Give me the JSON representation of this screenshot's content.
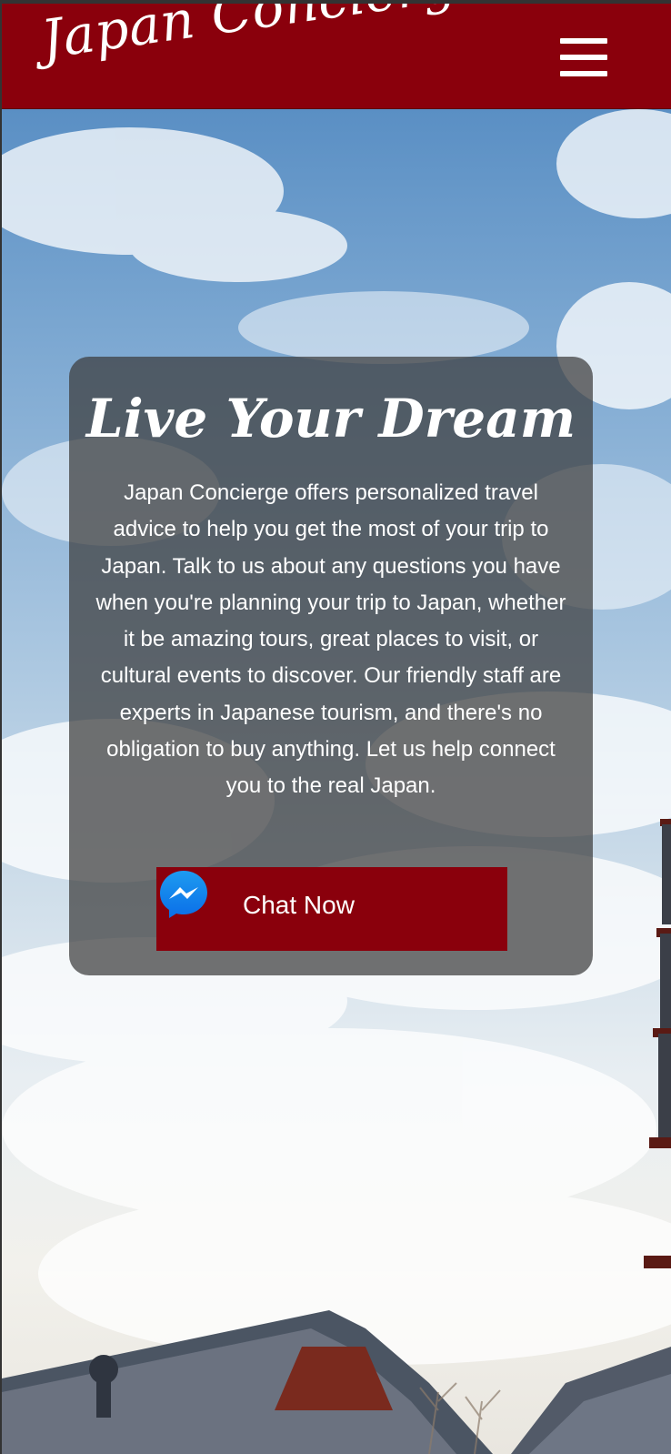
{
  "header": {
    "logo_text": "Japan Concierge",
    "menu_icon": "hamburger-menu-icon"
  },
  "hero": {
    "title": "Live Your Dream",
    "body": "Japan Concierge offers personalized travel advice to help you get the most of your trip to Japan. Talk to us about any questions you have when you're planning your trip to Japan, whether it be amazing tours, great places to visit, or cultural events to discover. Our friendly staff are experts in Japanese tourism, and there's no obligation to buy anything. Let us help connect you to the real Japan.",
    "cta_label": "Chat Now",
    "cta_icon": "messenger-icon"
  },
  "colors": {
    "brand_red": "#8a000c",
    "card_overlay": "rgba(60,60,60,0.72)",
    "text": "#ffffff"
  }
}
